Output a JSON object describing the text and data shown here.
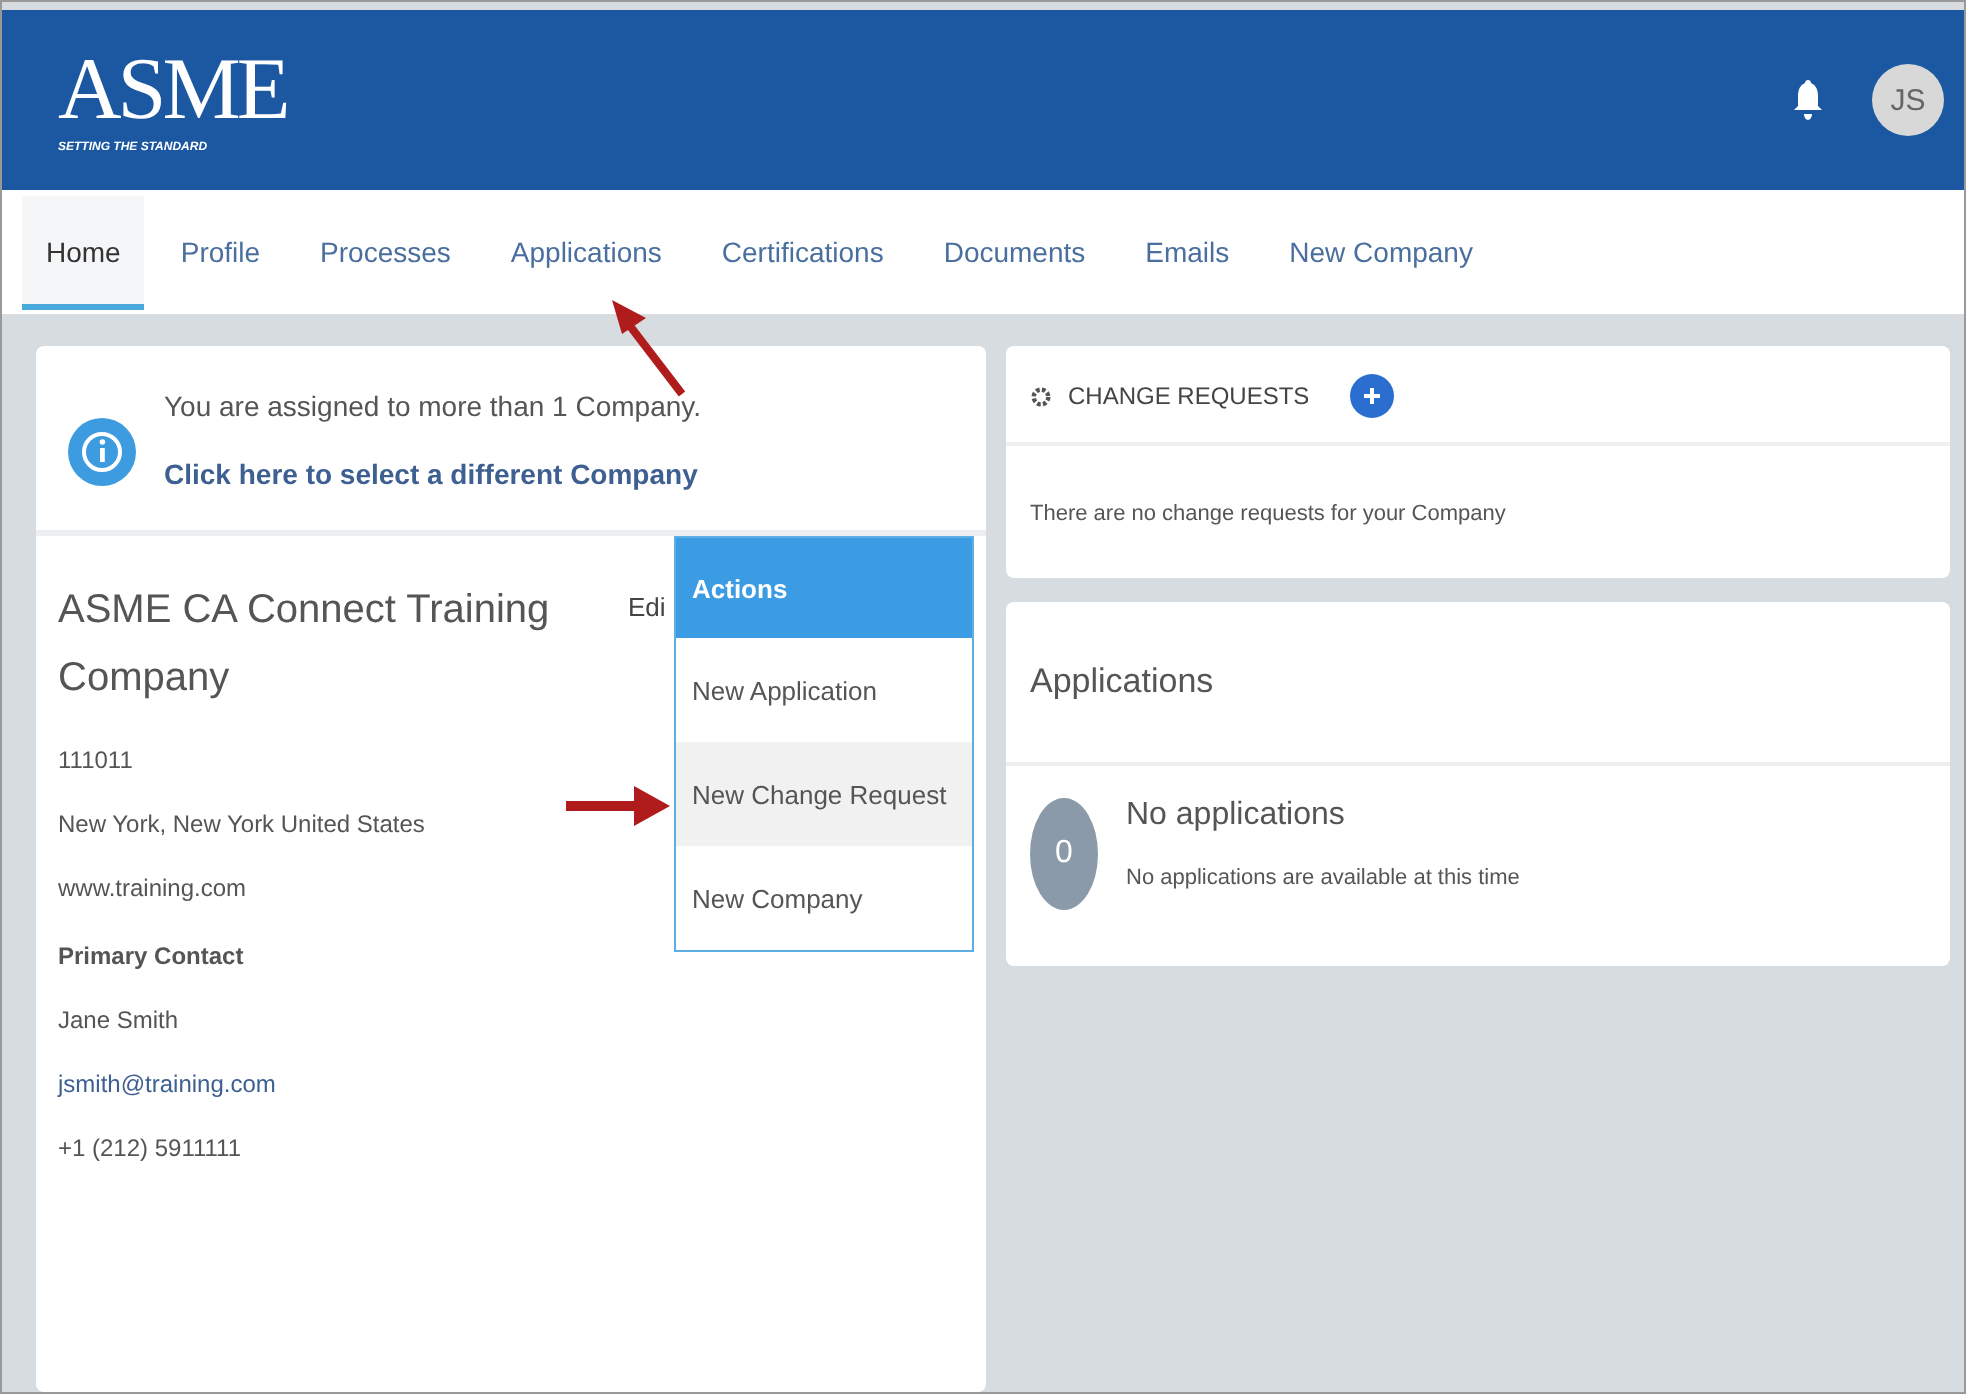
{
  "header": {
    "logo": "ASME",
    "tagline": "SETTING THE STANDARD",
    "avatar": "JS"
  },
  "tabs": [
    {
      "label": "Home",
      "selected": true
    },
    {
      "label": "Profile",
      "selected": false
    },
    {
      "label": "Processes",
      "selected": false
    },
    {
      "label": "Applications",
      "selected": false
    },
    {
      "label": "Certifications",
      "selected": false
    },
    {
      "label": "Documents",
      "selected": false
    },
    {
      "label": "Emails",
      "selected": false
    },
    {
      "label": "New Company",
      "selected": false
    }
  ],
  "notice": {
    "message": "You are assigned to more than 1 Company.",
    "link": "Click here to select a different Company"
  },
  "company": {
    "name": "ASME CA Connect Training Company",
    "edit": "Edi",
    "number": "111011",
    "location": "New York, New York United States",
    "website": "www.training.com",
    "contact_heading": "Primary Contact",
    "contact_name": "Jane Smith",
    "contact_email": "jsmith@training.com",
    "contact_phone": "+1 (212) 5911111"
  },
  "actions_menu": {
    "title": "Actions",
    "items": [
      {
        "label": "New Application",
        "selected": false
      },
      {
        "label": "New Change Request",
        "selected": true
      },
      {
        "label": "New Company",
        "selected": false
      }
    ]
  },
  "change_requests": {
    "title": "CHANGE REQUESTS",
    "empty": "There are no change requests for your Company"
  },
  "applications": {
    "title": "Applications",
    "count": "0",
    "empty_title": "No applications",
    "empty_text": "No applications are available at this time"
  }
}
